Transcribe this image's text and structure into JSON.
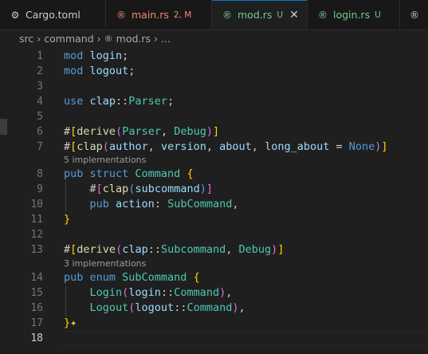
{
  "tabs": [
    {
      "label": "Cargo.toml",
      "badge": "",
      "icon": "gear-icon",
      "glyph": "⚙",
      "color": "#cccccc",
      "badge_color": "#cccccc",
      "active": false
    },
    {
      "label": "main.rs",
      "badge": "2, M",
      "icon": "rust-icon",
      "glyph": "®",
      "color": "#f48771",
      "badge_color": "#f48771",
      "active": false
    },
    {
      "label": "mod.rs",
      "badge": "U",
      "icon": "rust-icon",
      "glyph": "®",
      "color": "#73c991",
      "badge_color": "#73c991",
      "active": true
    },
    {
      "label": "login.rs",
      "badge": "U",
      "icon": "rust-icon",
      "glyph": "®",
      "color": "#73c991",
      "badge_color": "#73c991",
      "active": false
    },
    {
      "label": "",
      "badge": "",
      "icon": "rust-icon",
      "glyph": "®",
      "color": "#cccccc",
      "badge_color": "#cccccc",
      "active": false
    }
  ],
  "breadcrumb": {
    "root": "src",
    "folder": "command",
    "file": "mod.rs",
    "tail": "..."
  },
  "codelens": {
    "line7": "5 implementations",
    "line13": "3 implementations"
  },
  "editor": {
    "current_line": 18
  },
  "lines": [
    {
      "n": "1",
      "t": [
        [
          "k1",
          "mod "
        ],
        [
          "pm",
          "login"
        ],
        [
          "",
          "; "
        ]
      ]
    },
    {
      "n": "2",
      "t": [
        [
          "k1",
          "mod "
        ],
        [
          "pm",
          "logout"
        ],
        [
          "",
          ";"
        ]
      ]
    },
    {
      "n": "3",
      "t": []
    },
    {
      "n": "4",
      "t": [
        [
          "k1",
          "use "
        ],
        [
          "pm",
          "clap"
        ],
        [
          "",
          "::"
        ],
        [
          "ty",
          "Parser"
        ],
        [
          "",
          ";"
        ]
      ]
    },
    {
      "n": "5",
      "t": []
    },
    {
      "n": "6",
      "t": [
        [
          "",
          "#"
        ],
        [
          "br",
          "["
        ],
        [
          "at",
          "derive"
        ],
        [
          "br2",
          "("
        ],
        [
          "ty",
          "Parser"
        ],
        [
          "",
          ", "
        ],
        [
          "ty",
          "Debug"
        ],
        [
          "br2",
          ")"
        ],
        [
          "br",
          "]"
        ]
      ]
    },
    {
      "n": "7",
      "t": [
        [
          "",
          "#"
        ],
        [
          "br",
          "["
        ],
        [
          "at",
          "clap"
        ],
        [
          "br2",
          "("
        ],
        [
          "pm",
          "author"
        ],
        [
          "",
          ", "
        ],
        [
          "pm",
          "version"
        ],
        [
          "",
          ", "
        ],
        [
          "pm",
          "about"
        ],
        [
          "",
          ", "
        ],
        [
          "pm",
          "long_about"
        ],
        [
          "",
          " = "
        ],
        [
          "k1",
          "None"
        ],
        [
          "br2",
          ")"
        ],
        [
          "br",
          "]"
        ]
      ]
    },
    {
      "n": "8",
      "t": [
        [
          "k1",
          "pub struct "
        ],
        [
          "ty",
          "Command"
        ],
        [
          "",
          " "
        ],
        [
          "br",
          "{"
        ]
      ]
    },
    {
      "n": "9",
      "t": [
        [
          "",
          "    #"
        ],
        [
          "br2",
          "["
        ],
        [
          "at",
          "clap"
        ],
        [
          "k1",
          "("
        ],
        [
          "pm",
          "subcommand"
        ],
        [
          "k1",
          ")"
        ],
        [
          "br2",
          "]"
        ]
      ]
    },
    {
      "n": "10",
      "t": [
        [
          "k1",
          "    pub "
        ],
        [
          "pm",
          "action"
        ],
        [
          "",
          ": "
        ],
        [
          "ty",
          "SubCommand"
        ],
        [
          "",
          ","
        ]
      ]
    },
    {
      "n": "11",
      "t": [
        [
          "br",
          "}"
        ]
      ]
    },
    {
      "n": "12",
      "t": []
    },
    {
      "n": "13",
      "t": [
        [
          "",
          "#"
        ],
        [
          "br",
          "["
        ],
        [
          "at",
          "derive"
        ],
        [
          "br2",
          "("
        ],
        [
          "pm",
          "clap"
        ],
        [
          "",
          "::"
        ],
        [
          "ty",
          "Subcommand"
        ],
        [
          "",
          ", "
        ],
        [
          "ty",
          "Debug"
        ],
        [
          "br2",
          ")"
        ],
        [
          "br",
          "]"
        ]
      ]
    },
    {
      "n": "14",
      "t": [
        [
          "k1",
          "pub enum "
        ],
        [
          "ty",
          "SubCommand"
        ],
        [
          "",
          " "
        ],
        [
          "br",
          "{"
        ]
      ]
    },
    {
      "n": "15",
      "t": [
        [
          "ty",
          "    Login"
        ],
        [
          "br2",
          "("
        ],
        [
          "pm",
          "login"
        ],
        [
          "",
          "::"
        ],
        [
          "ty",
          "Command"
        ],
        [
          "br2",
          ")"
        ],
        [
          "",
          ","
        ]
      ]
    },
    {
      "n": "16",
      "t": [
        [
          "ty",
          "    Logout"
        ],
        [
          "br2",
          "("
        ],
        [
          "pm",
          "logout"
        ],
        [
          "",
          "::"
        ],
        [
          "ty",
          "Command"
        ],
        [
          "br2",
          ")"
        ],
        [
          "",
          ","
        ]
      ]
    },
    {
      "n": "17",
      "t": [
        [
          "br",
          "}"
        ]
      ]
    },
    {
      "n": "18",
      "t": []
    }
  ],
  "sparkle": "✦"
}
